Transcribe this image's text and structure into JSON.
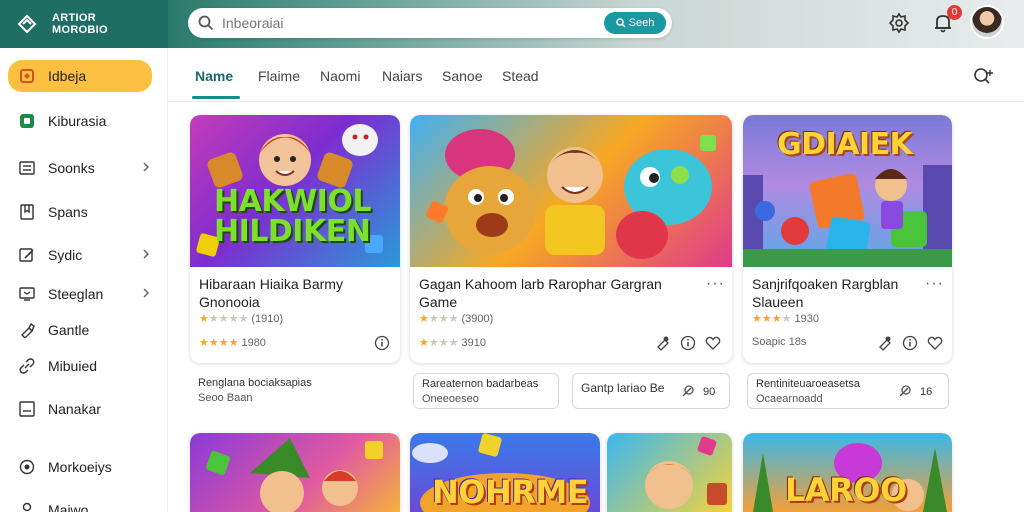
{
  "brand": {
    "logo_line1": "ARTIOR",
    "logo_line2": "MOROBIO"
  },
  "search": {
    "placeholder": "Inbeoraiai",
    "button_label": "Seeh"
  },
  "notifications": {
    "count": "0"
  },
  "sidebar": {
    "items": [
      {
        "label": "Idbeja",
        "icon": "puzzle-icon",
        "active": true
      },
      {
        "label": "Kiburasia",
        "icon": "square-icon"
      },
      {
        "label": "Soonks",
        "icon": "list-icon",
        "chevron": true
      },
      {
        "label": "Spans",
        "icon": "bookmark-icon"
      },
      {
        "label": "Sydic",
        "icon": "edit-icon",
        "chevron": true
      },
      {
        "label": "Steeglan",
        "icon": "tv-icon",
        "chevron": true
      },
      {
        "label": "Gantle",
        "icon": "brush-icon"
      },
      {
        "label": "Mibuied",
        "icon": "link-icon"
      },
      {
        "label": "Nanakar",
        "icon": "box-icon"
      },
      {
        "label": "Morkoeiys",
        "icon": "circle-icon"
      },
      {
        "label": "Maiwo",
        "icon": "user-icon"
      }
    ]
  },
  "tabs": [
    {
      "label": "Name",
      "active": true
    },
    {
      "label": "Flaime"
    },
    {
      "label": "Naomi"
    },
    {
      "label": "Naiars"
    },
    {
      "label": "Sanoe"
    },
    {
      "label": "Stead"
    }
  ],
  "cards": [
    {
      "thumb_title_line1": "HAKWIOL",
      "thumb_title_line2": "HILDIKEN",
      "title_line1": "Hibaraan Hiaika Barmy",
      "title_line2": "Gnonooia",
      "rating_line1": "(1910)",
      "rating_line2": "1980"
    },
    {
      "thumb_title_line1": "",
      "thumb_title_line2": "",
      "title_line1": "Gagan Kahoom larb Rarophar Gargran",
      "title_line2": "Game",
      "rating_line1": "(3900)",
      "rating_line2": "3910"
    },
    {
      "thumb_title_line1": "GDIAIEK",
      "thumb_title_line2": "",
      "title_line1": "Sanjrifqoaken Rargblan",
      "title_line2": "Slaueen",
      "rating_line1": "1930",
      "rating_line2": "Soapic 18s"
    }
  ],
  "info_boxes": [
    {
      "line1": "Renglana bociaksapias",
      "line2": "Seoo Baan"
    },
    {
      "line1": "Rareaternon badarbeas",
      "line2": "Oneeoeseo"
    },
    {
      "line1": "Gantp lariao Be",
      "line2": "",
      "extra": "90"
    },
    {
      "line1": "Rentiniteuaroeasetsa",
      "line2": "Ocaearnoadd",
      "extra": "16"
    }
  ],
  "bottom_cards": [
    {
      "thumb_title": ""
    },
    {
      "thumb_title": "NOHRME"
    },
    {
      "thumb_title": ""
    },
    {
      "thumb_title": "LAROO"
    }
  ],
  "colors": {
    "accent": "#1a9aa0",
    "sidebar_active": "#fbc03f",
    "header_dark": "#1f6e63",
    "badge": "#e53935",
    "star": "#f5a623"
  }
}
